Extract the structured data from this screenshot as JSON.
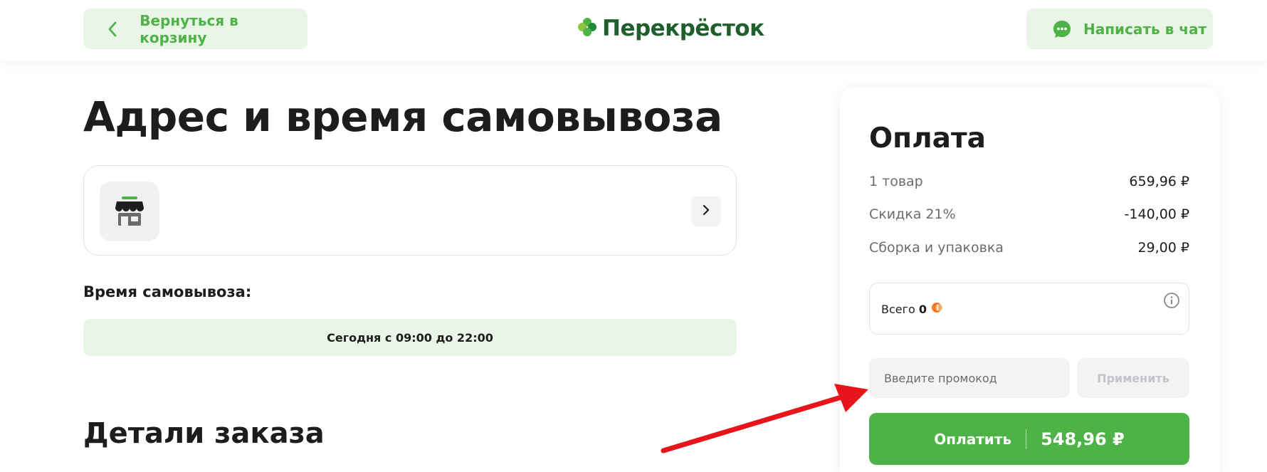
{
  "header": {
    "back_label": "Вернуться в корзину",
    "logo_text": "Перекрёсток",
    "chat_label": "Написать в чат"
  },
  "main": {
    "title": "Адрес и время самовывоза",
    "pickup_time_label": "Время самовывоза:",
    "pickup_slot": "Сегодня с 09:00 до 22:00",
    "order_details_title": "Детали заказа"
  },
  "payment": {
    "title": "Оплата",
    "rows": [
      {
        "label": "1 товар",
        "value": "659,96 ₽"
      },
      {
        "label": "Скидка 21%",
        "value": "-140,00 ₽"
      },
      {
        "label": "Сборка и упаковка",
        "value": "29,00 ₽"
      }
    ],
    "bonus_label": "Всего",
    "bonus_value": "0",
    "promo_placeholder": "Введите промокод",
    "apply_label": "Применить",
    "pay_label": "Оплатить",
    "pay_total": "548,96 ₽"
  },
  "colors": {
    "brand_green": "#4eb347",
    "brand_dark_green": "#1f5e2d",
    "light_green_bg": "#e9f5e6",
    "annotation_red": "#e8141b"
  },
  "icons": {
    "back": "chevron-left-icon",
    "logo": "clover-logo-icon",
    "chat": "chat-bubble-icon",
    "store": "store-icon",
    "store_arrow": "chevron-right-icon",
    "bonus": "bonus-coin-icon",
    "info": "info-icon"
  }
}
